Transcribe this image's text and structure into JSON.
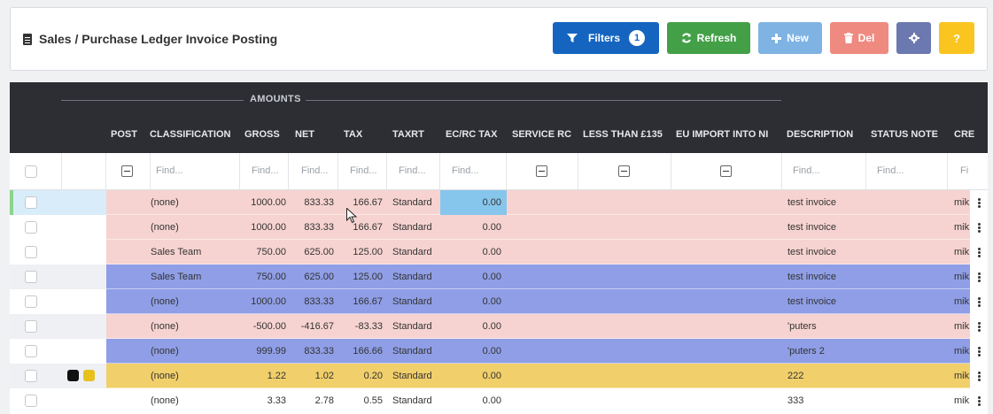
{
  "header": {
    "title": "Sales / Purchase Ledger Invoice Posting"
  },
  "toolbar": {
    "filters_label": "Filters",
    "filters_count": "1",
    "refresh_label": "Refresh",
    "new_label": "New",
    "del_label": "Del",
    "help_label": "?"
  },
  "grid": {
    "group_label": "AMOUNTS",
    "columns": {
      "post": "POST",
      "classification": "CLASSIFICATION",
      "gross": "GROSS",
      "net": "NET",
      "tax": "TAX",
      "taxrt": "TAXRT",
      "ecrc": "EC/RC TAX",
      "servicerc": "SERVICE RC",
      "lessthan": "LESS THAN £135",
      "euimport": "EU IMPORT INTO NI",
      "description": "DESCRIPTION",
      "statusnote": "STATUS NOTE",
      "cre": "CRE"
    },
    "find_placeholder": "Find...",
    "find_short": "Fi",
    "rows": [
      {
        "classification": "(none)",
        "gross": "1000.00",
        "net": "833.33",
        "tax": "166.67",
        "taxrt": "Standard",
        "ecrc": "0.00",
        "description": "test invoice",
        "cre": "mik"
      },
      {
        "classification": "(none)",
        "gross": "1000.00",
        "net": "833.33",
        "tax": "166.67",
        "taxrt": "Standard",
        "ecrc": "0.00",
        "description": "test invoice",
        "cre": "mik"
      },
      {
        "classification": "Sales Team",
        "gross": "750.00",
        "net": "625.00",
        "tax": "125.00",
        "taxrt": "Standard",
        "ecrc": "0.00",
        "description": "test invoice",
        "cre": "mik"
      },
      {
        "classification": "Sales Team",
        "gross": "750.00",
        "net": "625.00",
        "tax": "125.00",
        "taxrt": "Standard",
        "ecrc": "0.00",
        "description": "test invoice",
        "cre": "mik"
      },
      {
        "classification": "(none)",
        "gross": "1000.00",
        "net": "833.33",
        "tax": "166.67",
        "taxrt": "Standard",
        "ecrc": "0.00",
        "description": "test invoice",
        "cre": "mik"
      },
      {
        "classification": "(none)",
        "gross": "-500.00",
        "net": "-416.67",
        "tax": "-83.33",
        "taxrt": "Standard",
        "ecrc": "0.00",
        "description": "'puters",
        "cre": "mik"
      },
      {
        "classification": "(none)",
        "gross": "999.99",
        "net": "833.33",
        "tax": "166.66",
        "taxrt": "Standard",
        "ecrc": "0.00",
        "description": "'puters 2",
        "cre": "mik"
      },
      {
        "classification": "(none)",
        "gross": "1.22",
        "net": "1.02",
        "tax": "0.20",
        "taxrt": "Standard",
        "ecrc": "0.00",
        "description": "222",
        "cre": "mik"
      },
      {
        "classification": "(none)",
        "gross": "3.33",
        "net": "2.78",
        "tax": "0.55",
        "taxrt": "Standard",
        "ecrc": "0.00",
        "description": "333",
        "cre": "mik"
      }
    ]
  },
  "colors": {
    "filters_btn": "#1565c0",
    "refresh_btn": "#43a047",
    "new_btn": "#7fb3e3",
    "del_btn": "#ef8a80",
    "settings_btn": "#6c78b0",
    "help_btn": "#fbc520",
    "row_pink": "#f6d3d0",
    "row_blue": "#8f9ee6",
    "row_yellow": "#f1cf6a",
    "ecrc_highlight": "#87c6ec"
  }
}
